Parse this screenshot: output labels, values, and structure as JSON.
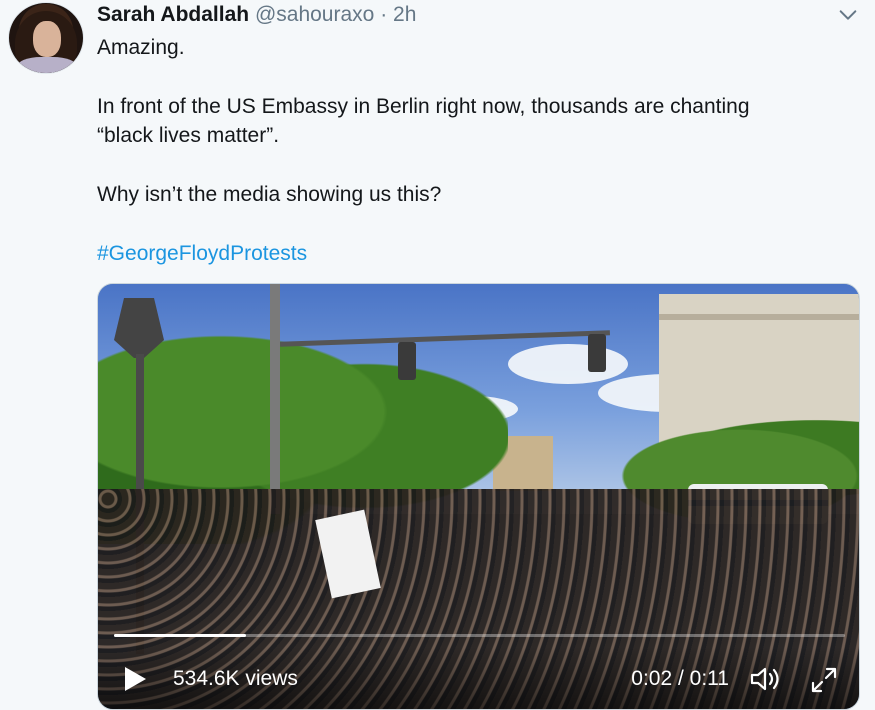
{
  "tweet": {
    "author_name": "Sarah Abdallah",
    "author_handle": "@sahouraxo",
    "separator": "·",
    "time": "2h",
    "lines": [
      "Amazing.",
      "In front of the US Embassy in Berlin right now, thousands are chanting",
      "“black lives matter”.",
      "Why isn’t the media showing us this?"
    ],
    "hashtag": "#GeorgeFloydProtests"
  },
  "video": {
    "views": "534.6K views",
    "timecode": "0:02 / 0:11",
    "progress_fraction": 0.18
  },
  "icons": {
    "more": "chevron-down-icon",
    "play": "play-icon",
    "volume": "volume-icon",
    "fullscreen": "fullscreen-icon"
  },
  "colors": {
    "link": "#1b95e0",
    "secondary": "#657786",
    "background": "#f5f8fa"
  }
}
